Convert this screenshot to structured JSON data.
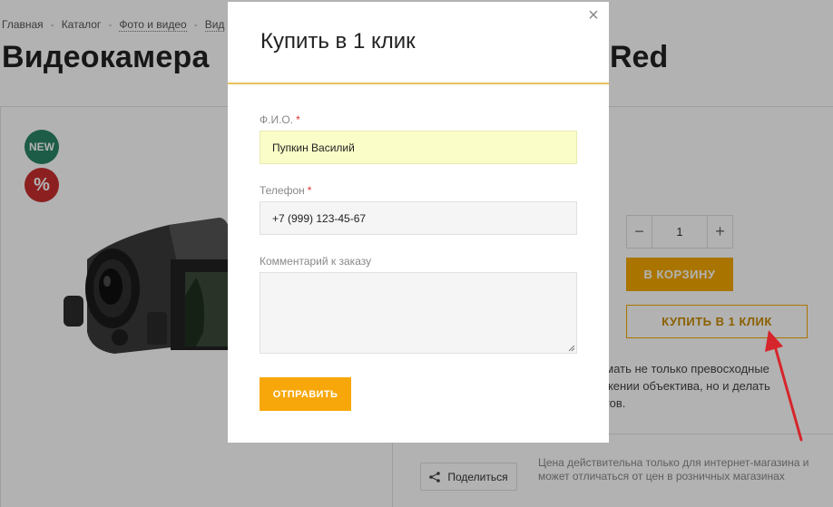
{
  "breadcrumbs": [
    "Главная",
    "Каталог",
    "Фото и видео",
    "Вид"
  ],
  "product": {
    "title_visible": "Видеокамера",
    "title_tail": "Red",
    "badge_new": "NEW",
    "badge_sale": "%",
    "quantity": "1",
    "add_to_cart": "В КОРЗИНУ",
    "buy_one_click": "КУПИТЬ В 1 КЛИК",
    "description": "имать не только превосходные\nожении объектива, но и делать\nктов.",
    "share": "Поделиться",
    "price_note": "Цена действительна только для интернет-магазина и может отличаться от цен в розничных магазинах"
  },
  "modal": {
    "title": "Купить в 1 клик",
    "close": "×",
    "name_label": "Ф.И.О.",
    "name_value": "Пупкин Василий",
    "phone_label": "Телефон",
    "phone_value": "+7 (999) 123-45-67",
    "comment_label": "Комментарий к заказу",
    "required_mark": "*",
    "submit": "ОТПРАВИТЬ"
  },
  "colors": {
    "accent": "#f7a70a",
    "badge_new": "#2a8566",
    "badge_sale": "#c92f2f",
    "arrow": "#d6252b"
  }
}
